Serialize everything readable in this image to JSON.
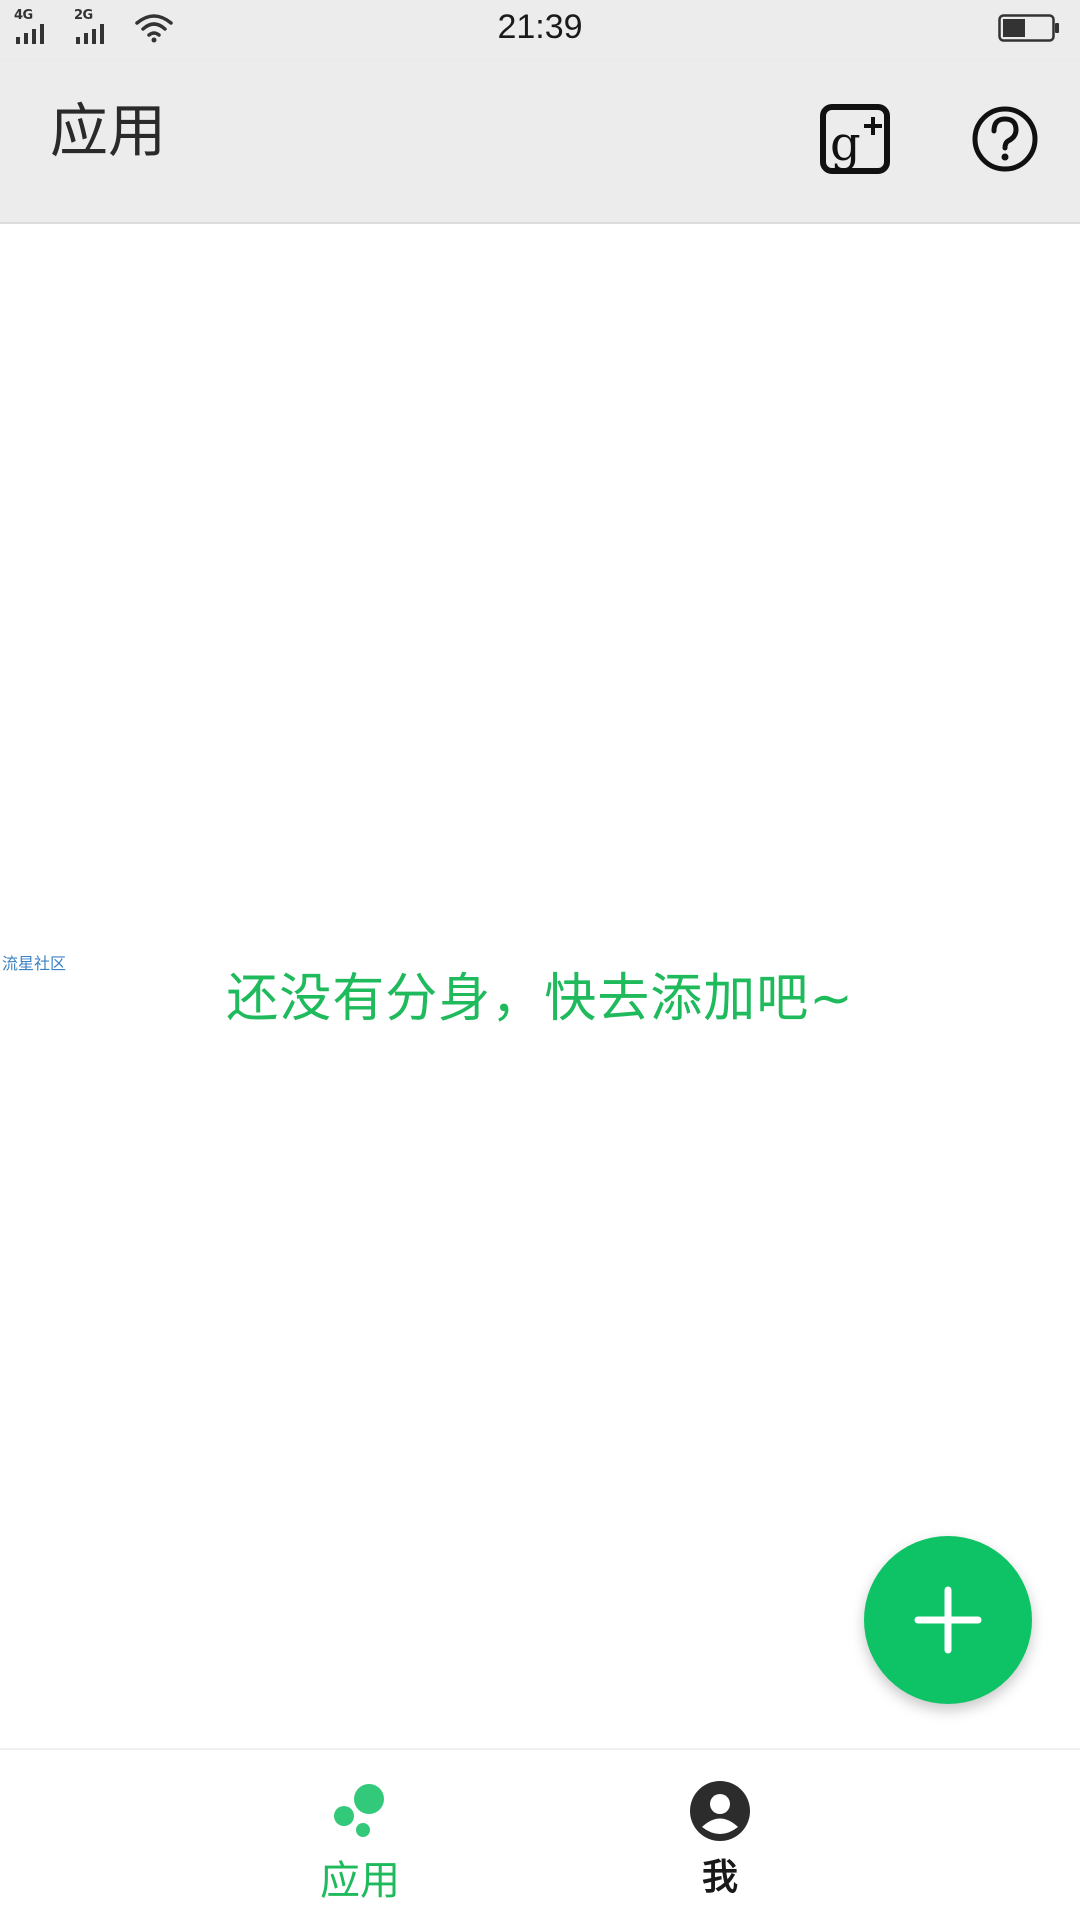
{
  "status_bar": {
    "signal_1_label": "4G",
    "signal_2_label": "2G",
    "time": "21:39",
    "battery_icon": "battery-icon",
    "wifi_icon": "wifi-icon"
  },
  "header": {
    "title": "应用",
    "actions": [
      {
        "icon": "google-plus-icon"
      },
      {
        "icon": "help-icon"
      }
    ]
  },
  "main": {
    "watermark": "流星社区",
    "empty_message": "还没有分身，快去添加吧~"
  },
  "fab": {
    "icon": "plus-icon"
  },
  "bottom_nav": {
    "items": [
      {
        "label": "应用",
        "icon": "apps-dots-icon",
        "active": true
      },
      {
        "label": "我",
        "icon": "profile-icon",
        "active": false
      }
    ]
  },
  "colors": {
    "accent": "#1fba5c",
    "fab": "#0dc365",
    "bar_background": "#ececec",
    "watermark": "#3b82c4"
  }
}
